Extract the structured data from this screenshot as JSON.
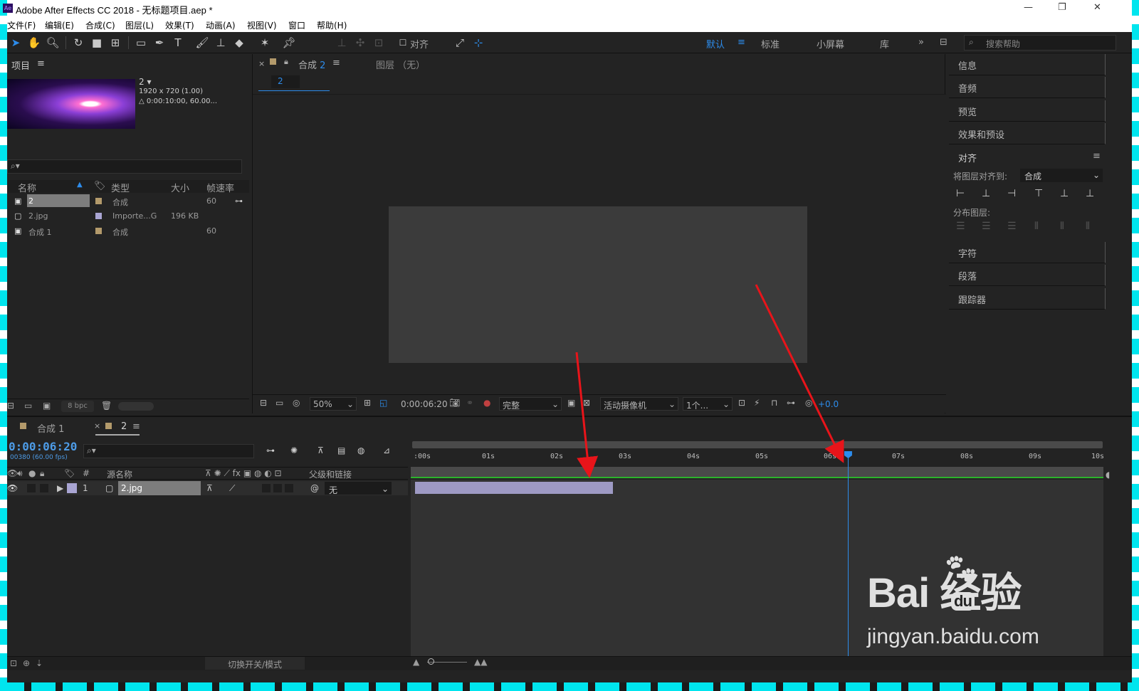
{
  "window": {
    "title": "Adobe After Effects CC 2018 - 无标题项目.aep *",
    "logo": "Ae"
  },
  "menu": [
    "文件(F)",
    "编辑(E)",
    "合成(C)",
    "图层(L)",
    "效果(T)",
    "动画(A)",
    "视图(V)",
    "窗口",
    "帮助(H)"
  ],
  "toolbar": {
    "align_label": "对齐",
    "workspaces": [
      "默认",
      "标准",
      "小屏幕",
      "库"
    ],
    "active_workspace": "默认",
    "help_placeholder": "搜索帮助"
  },
  "project": {
    "title": "项目",
    "comp_name": "2",
    "comp_resolution": "1920 x 720 (1.00)",
    "comp_duration": "△ 0:00:10:00, 60.00...",
    "columns": [
      "名称",
      "类型",
      "大小",
      "帧速率"
    ],
    "items": [
      {
        "name": "2",
        "type": "合成",
        "size": "",
        "fps": "60",
        "color": "#b39a6b",
        "selected": true
      },
      {
        "name": "2.jpg",
        "type": "Importe...G",
        "size": "196 KB",
        "fps": "",
        "color": "#a9a5d3",
        "selected": false
      },
      {
        "name": "合成 1",
        "type": "合成",
        "size": "",
        "fps": "60",
        "color": "#b39a6b",
        "selected": false
      }
    ],
    "bpc": "8 bpc"
  },
  "viewer": {
    "tab": "合成",
    "tab_num": "2",
    "layer_tab": "图层 （无）",
    "crumb": "2",
    "zoom": "50%",
    "timecode": "0:00:06:20",
    "quality": "完整",
    "camera": "活动摄像机",
    "views": "1个...",
    "exposure": "+0.0"
  },
  "right_panels": {
    "sections": [
      "信息",
      "音频",
      "预览",
      "效果和预设",
      "对齐"
    ],
    "align_to_label": "将图层对齐到:",
    "align_to_value": "合成",
    "distribute_label": "分布图层:",
    "bottom_sections": [
      "字符",
      "段落",
      "跟踪器"
    ]
  },
  "timeline": {
    "tabs": [
      "合成 1",
      "2"
    ],
    "timecode": "0:00:06:20",
    "frames": "00380 (60.00 fps)",
    "columns": {
      "num": "#",
      "source": "源名称",
      "parent": "父级和链接"
    },
    "layers": [
      {
        "index": "1",
        "name": "2.jpg",
        "parent": "无",
        "start": 0.0,
        "end": 2.9
      }
    ],
    "ruler": [
      ":00s",
      "01s",
      "02s",
      "03s",
      "04s",
      "05s",
      "06s",
      "07s",
      "08s",
      "09s",
      "10s"
    ],
    "playhead_seconds": 6.333,
    "footer_label": "切换开关/模式"
  },
  "watermark": {
    "brand": "Bai 经验",
    "du": "du",
    "url": "jingyan.baidu.com"
  },
  "colors": {
    "accent": "#2d8ceb",
    "arrow": "#e8141a",
    "frame": "#00e5ee",
    "layer_bar": "#9e9ac4"
  }
}
